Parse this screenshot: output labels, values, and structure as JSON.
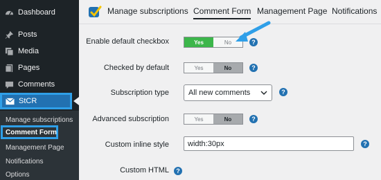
{
  "sidebar": {
    "items": [
      {
        "label": "Dashboard",
        "icon": "dashboard-icon"
      },
      {
        "label": "Posts",
        "icon": "pin-icon"
      },
      {
        "label": "Media",
        "icon": "media-icon"
      },
      {
        "label": "Pages",
        "icon": "pages-icon"
      },
      {
        "label": "Comments",
        "icon": "comments-icon"
      }
    ],
    "active_item": {
      "label": "StCR",
      "icon": "envelope-icon"
    },
    "submenu": [
      "Manage subscriptions",
      "Comment Form",
      "Management Page",
      "Notifications",
      "Options"
    ],
    "submenu_active_index": 1
  },
  "tabs": {
    "items": [
      "Manage subscriptions",
      "Comment Form",
      "Management Page",
      "Notifications"
    ],
    "active_index": 1
  },
  "form": {
    "enable_default_checkbox": {
      "label": "Enable default checkbox",
      "yes": "Yes",
      "no": "No",
      "selected": "Yes"
    },
    "checked_by_default": {
      "label": "Checked by default",
      "yes": "Yes",
      "no": "No",
      "selected": "No"
    },
    "subscription_type": {
      "label": "Subscription type",
      "value": "All new comments"
    },
    "advanced_subscription": {
      "label": "Advanced subscription",
      "yes": "Yes",
      "no": "No",
      "selected": "No"
    },
    "custom_inline_style": {
      "label": "Custom inline style",
      "value": "width:30px"
    },
    "custom_html": {
      "label": "Custom HTML"
    },
    "help_glyph": "?"
  },
  "colors": {
    "sidebar_bg": "#1d2327",
    "accent": "#2271b1",
    "highlight_border": "#2f9fe8",
    "toggle_yes": "#3cb64a",
    "annotation_arrow": "#2f9fe8"
  }
}
